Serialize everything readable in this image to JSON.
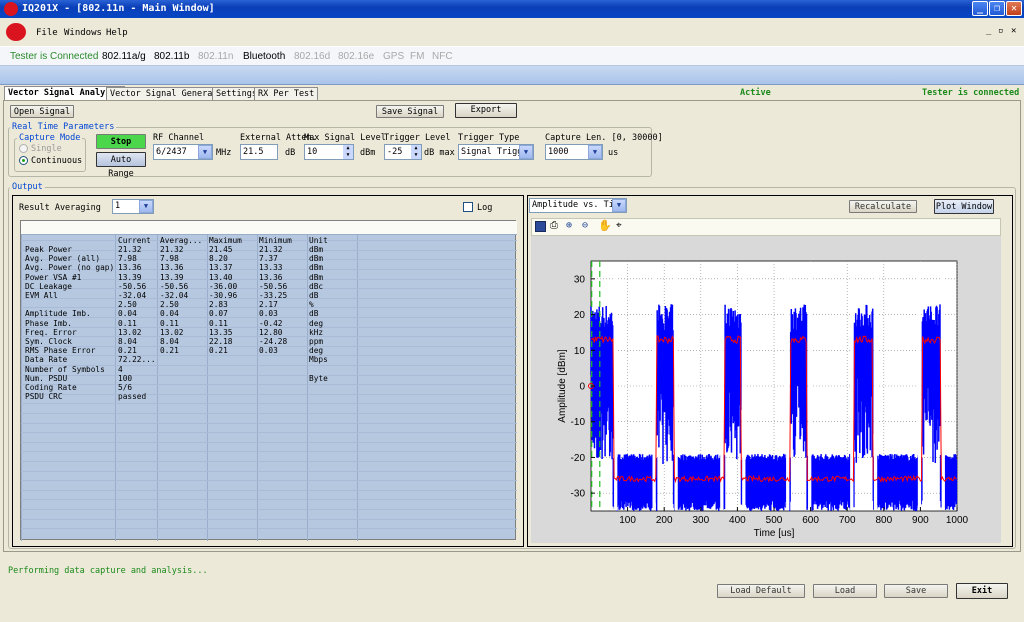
{
  "window": {
    "title": "IQ201X - [802.11n - Main Window]"
  },
  "menu": {
    "file": "File",
    "windows": "Windows",
    "help": "Help"
  },
  "tech_tabs": [
    "Tester is Connected",
    "802.11a/g",
    "802.11b",
    "802.11n",
    "Bluetooth",
    "802.16d",
    "802.16e",
    "GPS",
    "FM",
    "NFC"
  ],
  "tabs": [
    "Vector Signal Analyzer",
    "Vector Signal Generator",
    "Settings",
    "RX Per Test"
  ],
  "status_top": {
    "active": "Active",
    "tester": "Tester is connected"
  },
  "toolbar": {
    "open_signal": "Open Signal",
    "save_signal": "Save Signal",
    "export": "Export"
  },
  "rtp": {
    "title": "Real Time Parameters",
    "capture_mode": "Capture Mode",
    "single": "Single",
    "continuous": "Continuous",
    "stop": "Stop",
    "auto_range": "Auto Range",
    "rf_channel_label": "RF Channel",
    "rf_channel": "6/2437",
    "mhz": "MHz",
    "ext_atten_label": "External Atten.",
    "ext_atten": "21.5",
    "db": "dB",
    "max_level_label": "Max Signal Level",
    "max_level": "10",
    "dbm": "dBm",
    "trigger_level_label": "Trigger Level",
    "trigger_level": "-25",
    "db_max": "dB max",
    "trigger_type_label": "Trigger Type",
    "trigger_type": "Signal Trigger",
    "capture_len_label": "Capture Len. [0, 30000]",
    "capture_len": "1000",
    "us": "us"
  },
  "output": {
    "title": "Output",
    "result_averaging": "Result Averaging",
    "averaging": "1",
    "log": "Log",
    "headers": [
      "",
      "Current",
      "Averag...",
      "Maximum",
      "Minimum",
      "Unit"
    ],
    "rows": [
      [
        "Peak Power",
        "21.32",
        "21.32",
        "21.45",
        "21.32",
        "dBm"
      ],
      [
        "Avg. Power (all)",
        "7.98",
        "7.98",
        "8.20",
        "7.37",
        "dBm"
      ],
      [
        "Avg. Power (no gap)",
        "13.36",
        "13.36",
        "13.37",
        "13.33",
        "dBm"
      ],
      [
        "Power VSA #1",
        "13.39",
        "13.39",
        "13.40",
        "13.36",
        "dBm"
      ],
      [
        "DC Leakage",
        "-50.56",
        "-50.56",
        "-36.00",
        "-50.56",
        "dBc"
      ],
      [
        "EVM All",
        "-32.04",
        "-32.04",
        "-30.96",
        "-33.25",
        "dB"
      ],
      [
        "",
        "2.50",
        "2.50",
        "2.83",
        "2.17",
        "%"
      ],
      [
        "Amplitude Imb.",
        "0.04",
        "0.04",
        "0.07",
        "0.03",
        "dB"
      ],
      [
        "Phase Imb.",
        "0.11",
        "0.11",
        "0.11",
        "-0.42",
        "deg"
      ],
      [
        "Freq. Error",
        "13.02",
        "13.02",
        "13.35",
        "12.80",
        "kHz"
      ],
      [
        "Sym. Clock",
        "8.04",
        "8.04",
        "22.18",
        "-24.28",
        "ppm"
      ],
      [
        "RMS Phase Error",
        "0.21",
        "0.21",
        "0.21",
        "0.03",
        "deg"
      ],
      [
        "Data Rate",
        "72.22...",
        "",
        "",
        "",
        "Mbps"
      ],
      [
        "Number of Symbols",
        "4",
        "",
        "",
        "",
        ""
      ],
      [
        "Num. PSDU",
        "100",
        "",
        "",
        "",
        "Byte"
      ],
      [
        "Coding Rate",
        "5/6",
        "",
        "",
        "",
        ""
      ],
      [
        "PSDU CRC",
        "passed",
        "",
        "",
        "",
        ""
      ]
    ]
  },
  "plot": {
    "view": "Amplitude vs. Time",
    "recalculate": "Recalculate",
    "plot_window": "Plot Window"
  },
  "chart_data": {
    "type": "line",
    "xlabel": "Time [us]",
    "ylabel": "Amplitude [dBm]",
    "xlim": [
      0,
      1000
    ],
    "ylim": [
      -35,
      35
    ],
    "xticks": [
      100,
      200,
      300,
      400,
      500,
      600,
      700,
      800,
      900,
      1000
    ],
    "yticks": [
      30,
      20,
      10,
      0,
      -10,
      -20,
      -30
    ],
    "bursts": [
      [
        0,
        60
      ],
      [
        180,
        225
      ],
      [
        365,
        410
      ],
      [
        545,
        590
      ],
      [
        720,
        770
      ],
      [
        905,
        955
      ]
    ],
    "burst_level": 13,
    "noise_level": -26,
    "grid": true,
    "series_colors": [
      "#0000ff",
      "#ff0000"
    ]
  },
  "status": {
    "message": "Performing data capture and analysis..."
  },
  "bottom": {
    "load_default": "Load Default",
    "load": "Load",
    "save": "Save",
    "exit": "Exit"
  }
}
